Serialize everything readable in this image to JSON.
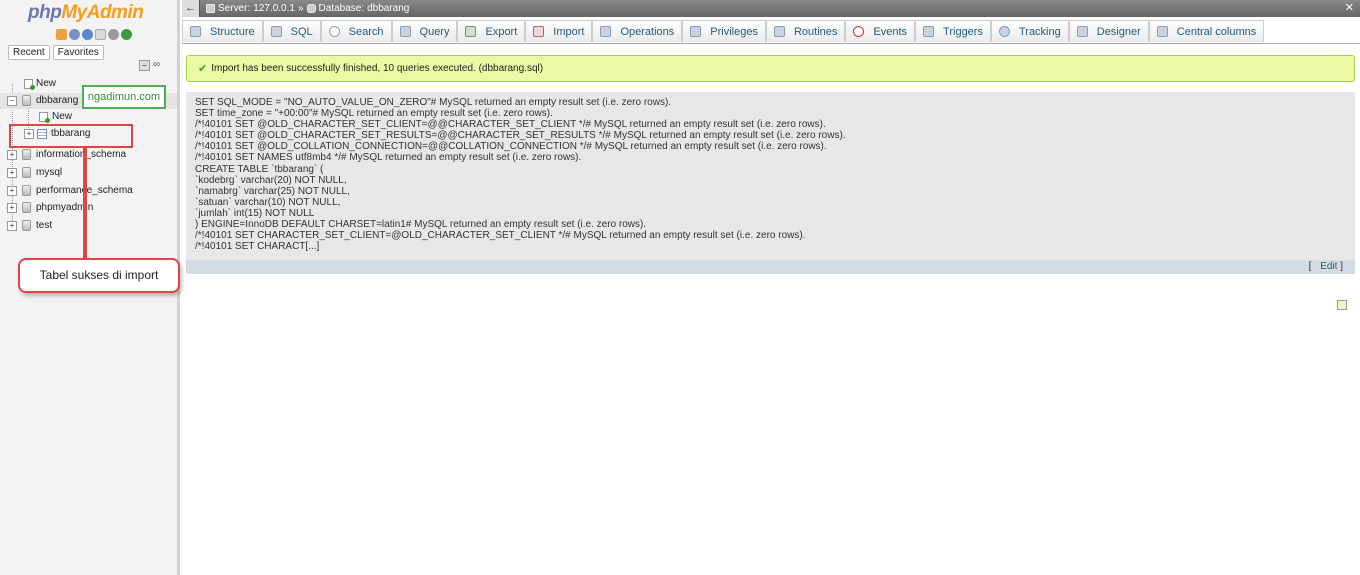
{
  "logo": {
    "php": "php",
    "myadmin": "MyAdmin"
  },
  "nav_tabs": [
    "Recent",
    "Favorites"
  ],
  "tree": {
    "new_top": "New",
    "db_current": "dbbarang",
    "new_sub": "New",
    "table": "tbbarang",
    "databases": [
      "information_schema",
      "mysql",
      "performance_schema",
      "phpmyadmin",
      "test"
    ]
  },
  "annotations": {
    "watermark": "ngadimun.com",
    "callout": "Tabel sukses di import"
  },
  "breadcrumb": {
    "server_label": "Server:",
    "server": "127.0.0.1",
    "separator": "»",
    "db_label": "Database:",
    "database": "dbbarang"
  },
  "tabs": [
    "Structure",
    "SQL",
    "Search",
    "Query",
    "Export",
    "Import",
    "Operations",
    "Privileges",
    "Routines",
    "Events",
    "Triggers",
    "Tracking",
    "Designer",
    "Central columns"
  ],
  "message": "Import has been successfully finished, 10 queries executed. (dbbarang.sql)",
  "sql_lines": [
    "SET SQL_MODE = \"NO_AUTO_VALUE_ON_ZERO\"# MySQL returned an empty result set (i.e. zero rows).",
    "SET time_zone = \"+00:00\"# MySQL returned an empty result set (i.e. zero rows).",
    "/*!40101 SET @OLD_CHARACTER_SET_CLIENT=@@CHARACTER_SET_CLIENT */# MySQL returned an empty result set (i.e. zero rows).",
    "/*!40101 SET @OLD_CHARACTER_SET_RESULTS=@@CHARACTER_SET_RESULTS */# MySQL returned an empty result set (i.e. zero rows).",
    "/*!40101 SET @OLD_COLLATION_CONNECTION=@@COLLATION_CONNECTION */# MySQL returned an empty result set (i.e. zero rows).",
    "/*!40101 SET NAMES utf8mb4 */# MySQL returned an empty result set (i.e. zero rows).",
    "CREATE TABLE `tbbarang` (",
    "`kodebrg` varchar(20) NOT NULL,",
    "`namabrg` varchar(25) NOT NULL,",
    "`satuan` varchar(10) NOT NULL,",
    "`jumlah` int(15) NOT NULL",
    ") ENGINE=InnoDB DEFAULT CHARSET=latin1# MySQL returned an empty result set (i.e. zero rows).",
    "/*!40101 SET CHARACTER_SET_CLIENT=@OLD_CHARACTER_SET_CLIENT */# MySQL returned an empty result set (i.e. zero rows).",
    "/*!40101 SET CHARACT[...]"
  ],
  "edit": {
    "open": "[",
    "label": "Edit",
    "close": "]"
  },
  "colors": {
    "success_bg": "#ebf8a4",
    "success_border": "#a2d246",
    "link": "#235a81",
    "annotation_red": "#e04444",
    "annotation_green": "#4caf50"
  }
}
